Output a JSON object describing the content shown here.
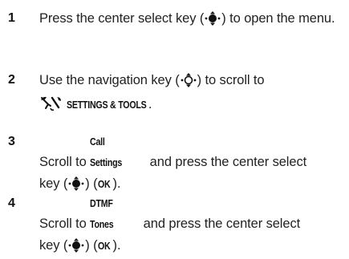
{
  "steps": [
    {
      "number": "1",
      "text_before": "Press the center select key (",
      "icon": "center-select-key-icon",
      "text_after": ") to open the menu.",
      "line2": "menu."
    },
    {
      "number": "2",
      "text_before": "Use the navigation key (",
      "icon": "navigation-key-icon",
      "text_after": ") to scroll to",
      "menu_icon": "settings-tools-icon",
      "menu_label": "SETTINGS & TOOLS",
      "menu_suffix": "."
    },
    {
      "number": "3",
      "text_a": "Scroll to ",
      "keyword": "Call Settings",
      "text_b": " and press the center select",
      "text_c": "key (",
      "icon": "center-select-key-icon",
      "text_d": ") (",
      "ok": "OK",
      "text_e": ")."
    },
    {
      "number": "4",
      "text_a": "Scroll to ",
      "keyword": "DTMF Tones",
      "text_b": " and press the center select",
      "text_c": "key (",
      "icon": "center-select-key-icon",
      "text_d": ") (",
      "ok": "OK",
      "text_e": ")."
    }
  ]
}
